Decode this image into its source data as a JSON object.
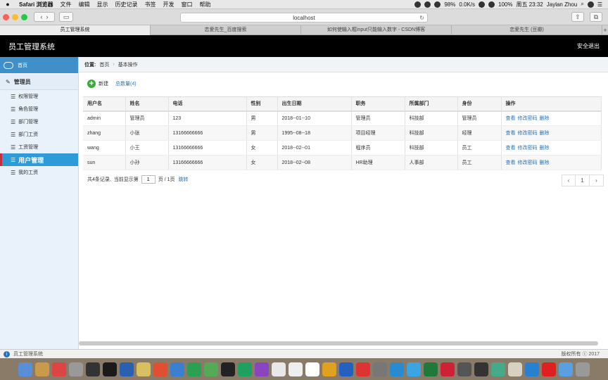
{
  "menubar": {
    "apple": "",
    "items": [
      "Safari 浏览器",
      "文件",
      "编辑",
      "显示",
      "历史记录",
      "书签",
      "开发",
      "窗口",
      "帮助"
    ],
    "battery": "98%",
    "net": "0.0K/s",
    "battery2": "100%",
    "clock": "周五 23:32",
    "user": "Jaylan Zhou"
  },
  "browser": {
    "address": "localhost",
    "tabs": [
      "员工管理系统",
      "恋爱先生_百度搜索",
      "如何使输入框input只能输入数字 - CSDN博客",
      "恋爱先生 (豆瓣)"
    ],
    "add_tab": "+"
  },
  "header": {
    "title": "员工管理系统",
    "logout": "安全退出"
  },
  "sidebar": {
    "home": "首页",
    "section": "管理员",
    "items": [
      {
        "label": "权限管理"
      },
      {
        "label": "角色管理"
      },
      {
        "label": "部门管理"
      },
      {
        "label": "部门工资"
      },
      {
        "label": "工资管理"
      },
      {
        "label": "用户管理",
        "active": true
      },
      {
        "label": "我的工资"
      }
    ]
  },
  "breadcrumb": {
    "prefix": "位置:",
    "home": "首页",
    "sep": "›",
    "current": "基本操作"
  },
  "toolbar": {
    "new_label": "新建",
    "total_label": "总数量(4)"
  },
  "table": {
    "headers": [
      "用户名",
      "姓名",
      "电话",
      "性别",
      "出生日期",
      "职务",
      "所属部门",
      "身份",
      "操作"
    ],
    "rows": [
      [
        "admin",
        "管理员",
        "123",
        "男",
        "2018--01--10",
        "管理员",
        "科技部",
        "管理员"
      ],
      [
        "zhang",
        "小张",
        "13166666666",
        "男",
        "1995--08--18",
        "项目经理",
        "科技部",
        "经理"
      ],
      [
        "wang",
        "小王",
        "13166666666",
        "女",
        "2018--02--01",
        "程序员",
        "科技部",
        "员工"
      ],
      [
        "sun",
        "小孙",
        "13166666666",
        "女",
        "2018--02--08",
        "HR助理",
        "人事部",
        "员工"
      ]
    ],
    "actions": [
      "查看",
      "修改密码",
      "删除"
    ]
  },
  "footer": {
    "records": "共4条记录,",
    "showing": "当前显示第",
    "page_value": "1",
    "pages": "页 / 1页",
    "jump": "跳转"
  },
  "pager": {
    "prev": "‹",
    "current": "1",
    "next": "›"
  },
  "statusbar": {
    "icon": "i",
    "left": "员工管理系统",
    "right": "版权所有 ⓒ 2017"
  },
  "dock": {
    "colors": [
      "#5a8fd6",
      "#c89a4a",
      "#d44",
      "#999",
      "#333",
      "#1a1a1a",
      "#2a60b0",
      "#d8c060",
      "#e05030",
      "#3b80d0",
      "#2aa050",
      "#5a5",
      "#222",
      "#1ea060",
      "#8a44c0",
      "#e8e8e8",
      "#eee",
      "#fff",
      "#e0a020",
      "#2460c0",
      "#d33",
      "#777",
      "#2a8ad0",
      "#3aa5e0",
      "#1f7a3a",
      "#c23",
      "#555",
      "#333",
      "#4a8",
      "#d8d0c0",
      "#2a80d0",
      "#e02020",
      "#5aa0e0",
      "#999"
    ]
  }
}
